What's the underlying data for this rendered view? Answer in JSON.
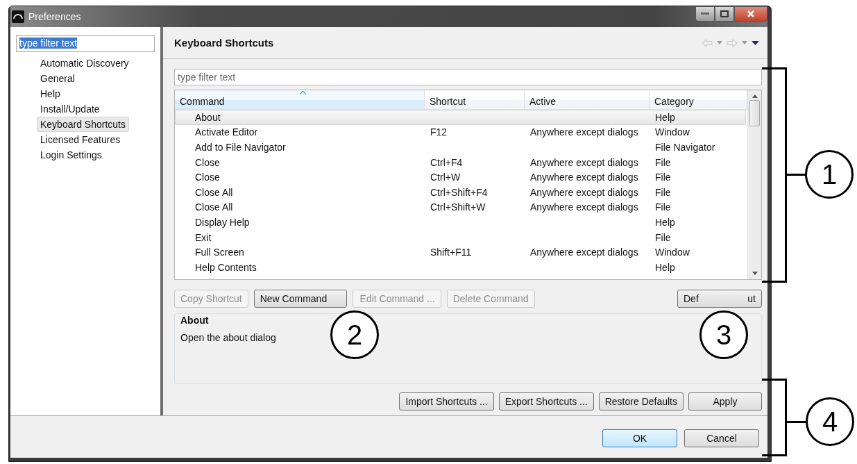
{
  "window": {
    "title": "Preferences"
  },
  "sidebar": {
    "filter": {
      "value": "type filter text",
      "highlighted": true
    },
    "items": [
      {
        "label": "Automatic Discovery",
        "selected": false
      },
      {
        "label": "General",
        "selected": false
      },
      {
        "label": "Help",
        "selected": false
      },
      {
        "label": "Install/Update",
        "selected": false
      },
      {
        "label": "Keyboard Shortcuts",
        "selected": true
      },
      {
        "label": "Licensed Features",
        "selected": false
      },
      {
        "label": "Login Settings",
        "selected": false
      }
    ]
  },
  "page": {
    "title": "Keyboard Shortcuts"
  },
  "filter": {
    "placeholder": "type filter text"
  },
  "table": {
    "columns": [
      {
        "label": "Command",
        "sorted": true
      },
      {
        "label": "Shortcut",
        "sorted": false
      },
      {
        "label": "Active",
        "sorted": false
      },
      {
        "label": "Category",
        "sorted": false
      }
    ],
    "rows": [
      {
        "cells": [
          "About",
          "",
          "",
          "Help"
        ],
        "selected": true
      },
      {
        "cells": [
          "Activate Editor",
          "F12",
          "Anywhere except dialogs",
          "Window"
        ],
        "selected": false
      },
      {
        "cells": [
          "Add to File Navigator",
          "",
          "",
          "File Navigator"
        ],
        "selected": false
      },
      {
        "cells": [
          "Close",
          "Ctrl+F4",
          "Anywhere except dialogs",
          "File"
        ],
        "selected": false
      },
      {
        "cells": [
          "Close",
          "Ctrl+W",
          "Anywhere except dialogs",
          "File"
        ],
        "selected": false
      },
      {
        "cells": [
          "Close All",
          "Ctrl+Shift+F4",
          "Anywhere except dialogs",
          "File"
        ],
        "selected": false
      },
      {
        "cells": [
          "Close All",
          "Ctrl+Shift+W",
          "Anywhere except dialogs",
          "File"
        ],
        "selected": false
      },
      {
        "cells": [
          "Display Help",
          "",
          "",
          "Help"
        ],
        "selected": false
      },
      {
        "cells": [
          "Exit",
          "",
          "",
          "File"
        ],
        "selected": false
      },
      {
        "cells": [
          "Full Screen",
          "Shift+F11",
          "Anywhere except dialogs",
          "Window"
        ],
        "selected": false
      },
      {
        "cells": [
          "Help Contents",
          "",
          "",
          "Help"
        ],
        "selected": false
      }
    ]
  },
  "command_buttons": [
    {
      "label": "Copy Shortcut",
      "disabled": true
    },
    {
      "label": "New Command",
      "disabled": false
    },
    {
      "label": "Edit Command ...",
      "disabled": true
    },
    {
      "label": "Delete Command",
      "disabled": true
    }
  ],
  "default_button": {
    "label_parts": [
      "Def",
      "ut"
    ]
  },
  "description": {
    "title": "About",
    "text": "Open the about dialog"
  },
  "action_buttons": [
    {
      "label": "Import Shortcuts ..."
    },
    {
      "label": "Export Shortcuts ..."
    },
    {
      "label": "Restore Defaults"
    },
    {
      "label": "Apply"
    }
  ],
  "dialog_buttons": [
    {
      "label": "OK",
      "default": true
    },
    {
      "label": "Cancel",
      "default": false
    }
  ],
  "callouts": [
    {
      "number": "1"
    },
    {
      "number": "2"
    },
    {
      "number": "3"
    },
    {
      "number": "4"
    }
  ]
}
